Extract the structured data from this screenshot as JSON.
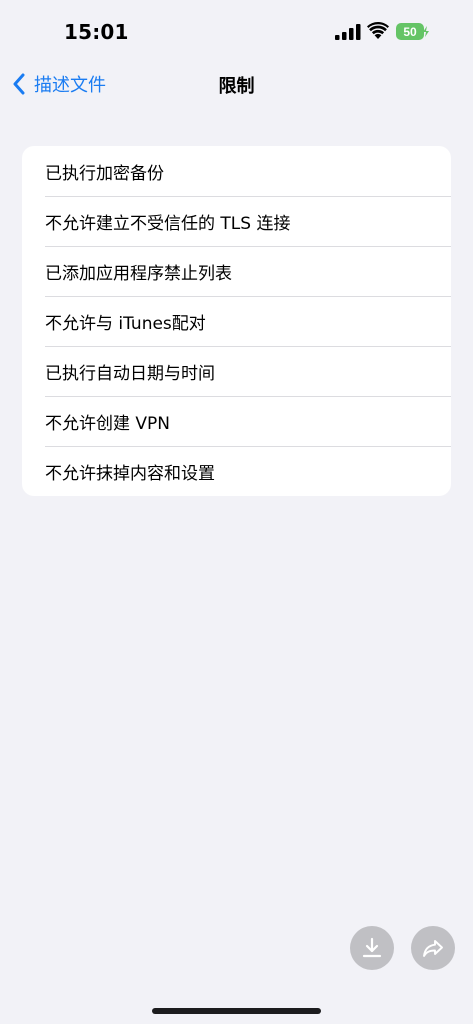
{
  "status_bar": {
    "time": "15:01",
    "battery_level": "50",
    "icons": [
      "signal-icon",
      "wifi-icon",
      "battery-icon"
    ]
  },
  "nav": {
    "back_label": "描述文件",
    "title": "限制"
  },
  "restrictions": [
    "已执行加密备份",
    "不允许建立不受信任的 TLS 连接",
    "已添加应用程序禁止列表",
    "不允许与 iTunes配对",
    "已执行自动日期与时间",
    "不允许创建 VPN",
    "不允许抹掉内容和设置"
  ],
  "actions": {
    "download_icon": "download-icon",
    "share_icon": "share-icon"
  },
  "colors": {
    "accent": "#1a7cf2",
    "background": "#f2f2f7",
    "battery": "#65c466"
  }
}
